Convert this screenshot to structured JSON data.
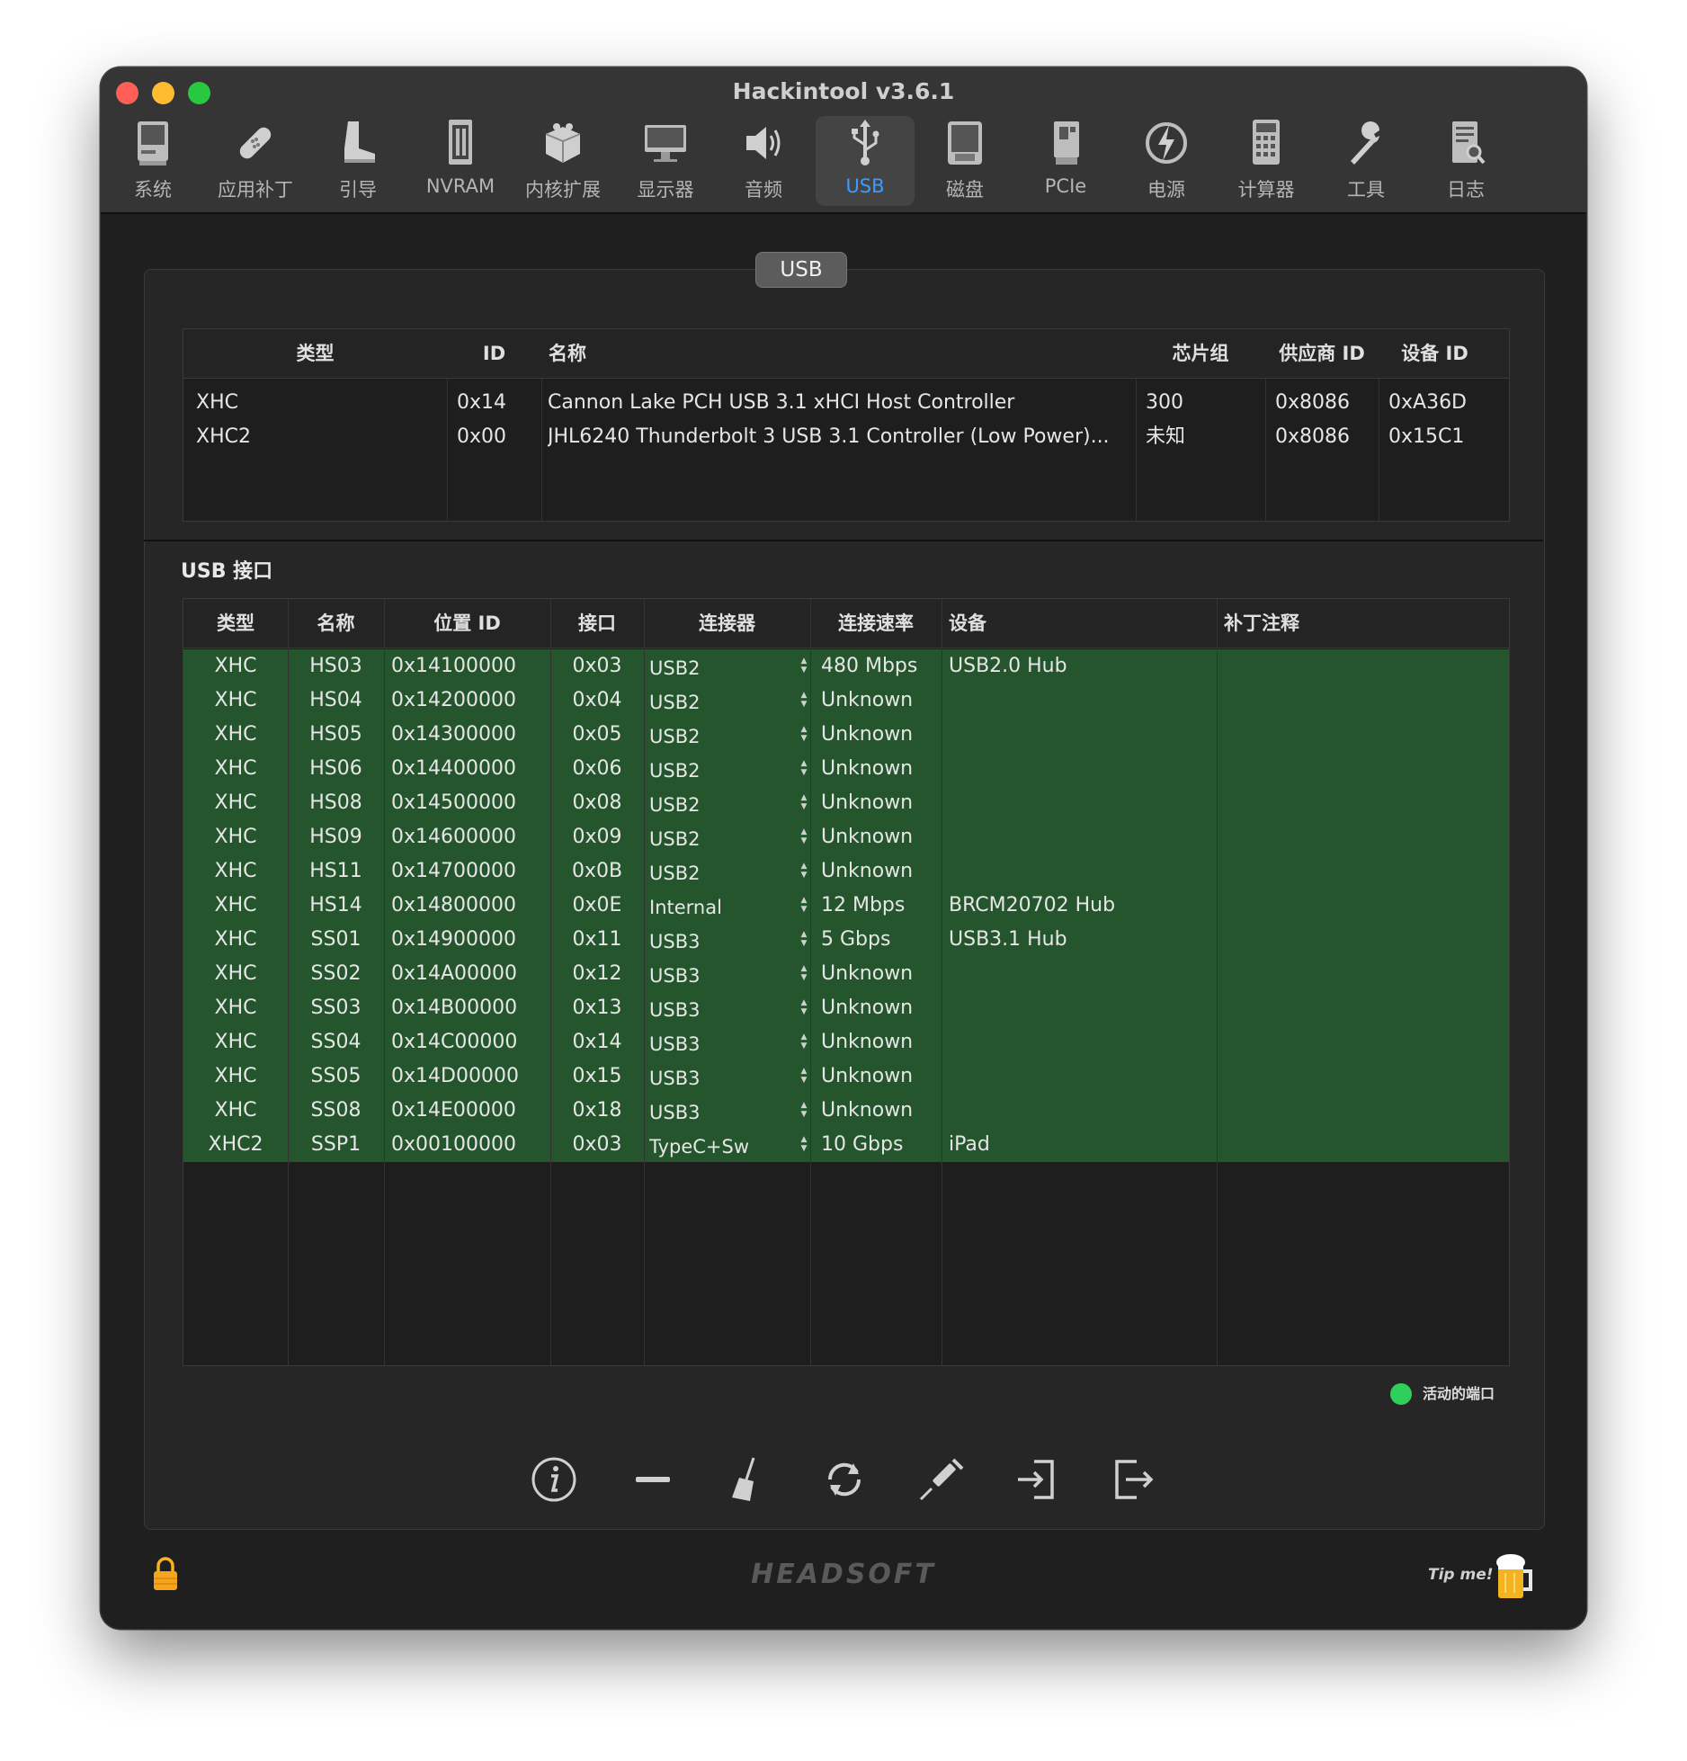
{
  "window": {
    "title": "Hackintool v3.6.1"
  },
  "toolbar": {
    "items": [
      {
        "label": "系统",
        "icon": "system-icon"
      },
      {
        "label": "应用补丁",
        "icon": "patch-icon"
      },
      {
        "label": "引导",
        "icon": "boot-icon"
      },
      {
        "label": "NVRAM",
        "icon": "nvram-icon"
      },
      {
        "label": "内核扩展",
        "icon": "kext-icon"
      },
      {
        "label": "显示器",
        "icon": "display-icon"
      },
      {
        "label": "音频",
        "icon": "audio-icon"
      },
      {
        "label": "USB",
        "icon": "usb-icon",
        "active": true
      },
      {
        "label": "磁盘",
        "icon": "disk-icon"
      },
      {
        "label": "PCIe",
        "icon": "pcie-icon"
      },
      {
        "label": "电源",
        "icon": "power-icon"
      },
      {
        "label": "计算器",
        "icon": "calculator-icon"
      },
      {
        "label": "工具",
        "icon": "tools-icon"
      },
      {
        "label": "日志",
        "icon": "log-icon"
      }
    ]
  },
  "panel": {
    "title": "USB"
  },
  "controllers": {
    "headers": [
      "类型",
      "ID",
      "名称",
      "芯片组",
      "供应商 ID",
      "设备 ID"
    ],
    "rows": [
      [
        "XHC",
        "0x14",
        "Cannon Lake PCH USB 3.1 xHCI Host Controller",
        "300",
        "0x8086",
        "0xA36D"
      ],
      [
        "XHC2",
        "0x00",
        "JHL6240 Thunderbolt 3 USB 3.1 Controller (Low Power)...",
        "未知",
        "0x8086",
        "0x15C1"
      ]
    ]
  },
  "ports": {
    "section_title": "USB 接口",
    "headers": [
      "类型",
      "名称",
      "位置 ID",
      "接口",
      "连接器",
      "连接速率",
      "设备",
      "补丁注释"
    ],
    "rows": [
      [
        "XHC",
        "HS03",
        "0x14100000",
        "0x03",
        "USB2",
        "480 Mbps",
        "USB2.0 Hub",
        ""
      ],
      [
        "XHC",
        "HS04",
        "0x14200000",
        "0x04",
        "USB2",
        "Unknown",
        "",
        ""
      ],
      [
        "XHC",
        "HS05",
        "0x14300000",
        "0x05",
        "USB2",
        "Unknown",
        "",
        ""
      ],
      [
        "XHC",
        "HS06",
        "0x14400000",
        "0x06",
        "USB2",
        "Unknown",
        "",
        ""
      ],
      [
        "XHC",
        "HS08",
        "0x14500000",
        "0x08",
        "USB2",
        "Unknown",
        "",
        ""
      ],
      [
        "XHC",
        "HS09",
        "0x14600000",
        "0x09",
        "USB2",
        "Unknown",
        "",
        ""
      ],
      [
        "XHC",
        "HS11",
        "0x14700000",
        "0x0B",
        "USB2",
        "Unknown",
        "",
        ""
      ],
      [
        "XHC",
        "HS14",
        "0x14800000",
        "0x0E",
        "Internal",
        "12 Mbps",
        "BRCM20702 Hub",
        ""
      ],
      [
        "XHC",
        "SS01",
        "0x14900000",
        "0x11",
        "USB3",
        "5 Gbps",
        "USB3.1 Hub",
        ""
      ],
      [
        "XHC",
        "SS02",
        "0x14A00000",
        "0x12",
        "USB3",
        "Unknown",
        "",
        ""
      ],
      [
        "XHC",
        "SS03",
        "0x14B00000",
        "0x13",
        "USB3",
        "Unknown",
        "",
        ""
      ],
      [
        "XHC",
        "SS04",
        "0x14C00000",
        "0x14",
        "USB3",
        "Unknown",
        "",
        ""
      ],
      [
        "XHC",
        "SS05",
        "0x14D00000",
        "0x15",
        "USB3",
        "Unknown",
        "",
        ""
      ],
      [
        "XHC",
        "SS08",
        "0x14E00000",
        "0x18",
        "USB3",
        "Unknown",
        "",
        ""
      ],
      [
        "XHC2",
        "SSP1",
        "0x00100000",
        "0x03",
        "TypeC+Sw",
        "10 Gbps",
        "iPad",
        ""
      ]
    ],
    "active_color": "#24552d"
  },
  "legend": {
    "label": "活动的端口",
    "color": "#2fd05a"
  },
  "actions": [
    {
      "icon": "info-icon"
    },
    {
      "icon": "minus-icon"
    },
    {
      "icon": "broom-icon"
    },
    {
      "icon": "refresh-icon"
    },
    {
      "icon": "syringe-icon"
    },
    {
      "icon": "import-icon"
    },
    {
      "icon": "export-icon"
    }
  ],
  "footer": {
    "brand": "HEADSOFT",
    "tip": "Tip me!"
  }
}
